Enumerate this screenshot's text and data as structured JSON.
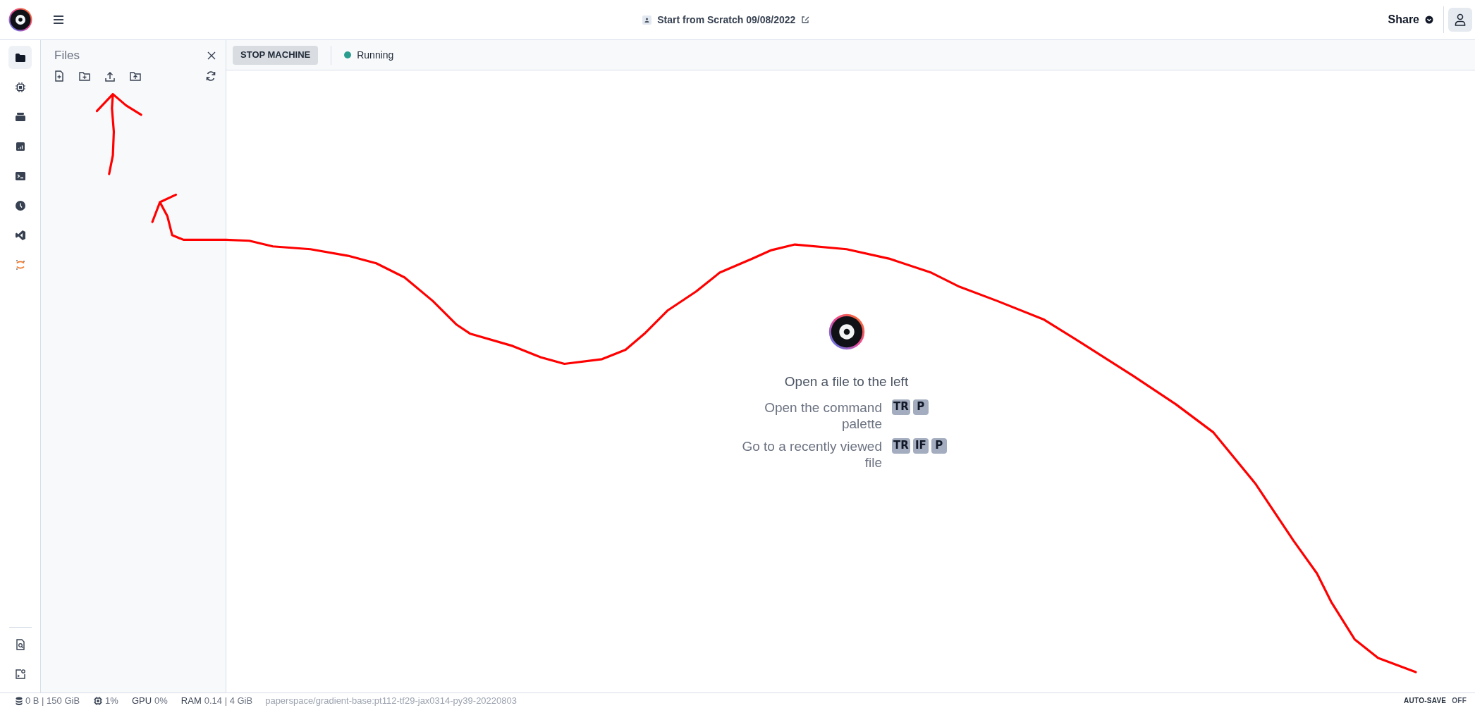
{
  "topbar": {
    "title": "Start from Scratch 09/08/2022",
    "share": "Share"
  },
  "rail": {
    "items": [
      {
        "selected": true
      },
      {
        "selected": false
      },
      {
        "selected": false
      },
      {
        "selected": false
      },
      {
        "selected": false
      },
      {
        "selected": false
      },
      {
        "selected": false
      },
      {
        "selected": false
      }
    ]
  },
  "files_panel": {
    "title": "Files"
  },
  "toolbar": {
    "stop_button": "STOP MACHINE",
    "status": "Running"
  },
  "welcome": {
    "heading": "Open a file to the left",
    "hints": [
      {
        "label": "Open the command palette",
        "keys": [
          "TR",
          "P"
        ]
      },
      {
        "label": "Go to a recently viewed file",
        "keys": [
          "TR",
          "IF",
          "P"
        ]
      }
    ]
  },
  "status_bar": {
    "storage": "0 B | 150 GiB",
    "cpu": "1%",
    "gpu_label": "GPU",
    "gpu": "0%",
    "ram_label": "RAM",
    "ram": "0.14 | 4 GiB",
    "image": "paperspace/gradient-base:pt112-tf29-jax0314-py39-20220803",
    "autosave_label": "AUTO-SAVE",
    "autosave_value": "OFF"
  }
}
